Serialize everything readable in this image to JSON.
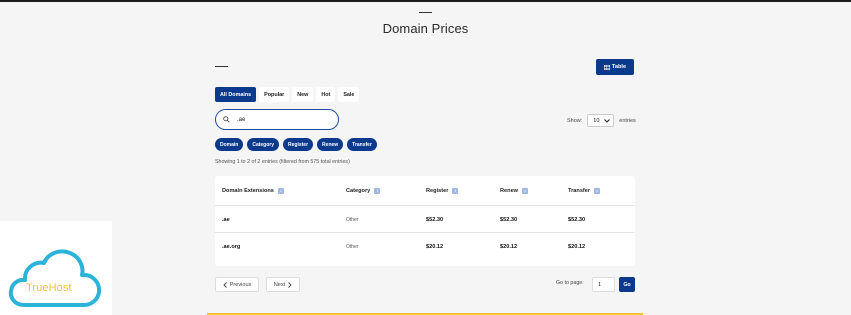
{
  "page": {
    "title": "Domain Prices"
  },
  "toolbar": {
    "table_label": "Table"
  },
  "filters": [
    {
      "label": "All Domains",
      "active": true
    },
    {
      "label": "Popular",
      "active": false
    },
    {
      "label": "New",
      "active": false
    },
    {
      "label": "Hot",
      "active": false
    },
    {
      "label": "Sale",
      "active": false
    }
  ],
  "search": {
    "value": ".ae",
    "icon": "search-icon"
  },
  "entries": {
    "show_label": "Show:",
    "selected": "10",
    "suffix": "entries"
  },
  "sort_chips": [
    "Domain",
    "Category",
    "Register",
    "Renew",
    "Transfer"
  ],
  "showing_text": "Showing 1 to 2 of 2 entries (filtered from 575 total entries)",
  "table": {
    "headers": [
      "Domain Extensions",
      "Category",
      "Register",
      "Renew",
      "Transfer"
    ],
    "rows": [
      {
        "domain": ".ae",
        "category": "Other",
        "register": "$52.30",
        "renew": "$52.30",
        "transfer": "$52.30"
      },
      {
        "domain": ".ae.org",
        "category": "Other",
        "register": "$20.12",
        "renew": "$20.12",
        "transfer": "$20.12"
      }
    ]
  },
  "pagination": {
    "previous": "Previous",
    "next": "Next",
    "goto_label": "Go to page:",
    "page_value": "1",
    "go_label": "Go"
  },
  "logo": {
    "text": "TrueHost"
  },
  "colors": {
    "accent": "#0b3a8c",
    "logo_cloud": "#2bb3d9",
    "logo_text": "#f2c232"
  }
}
